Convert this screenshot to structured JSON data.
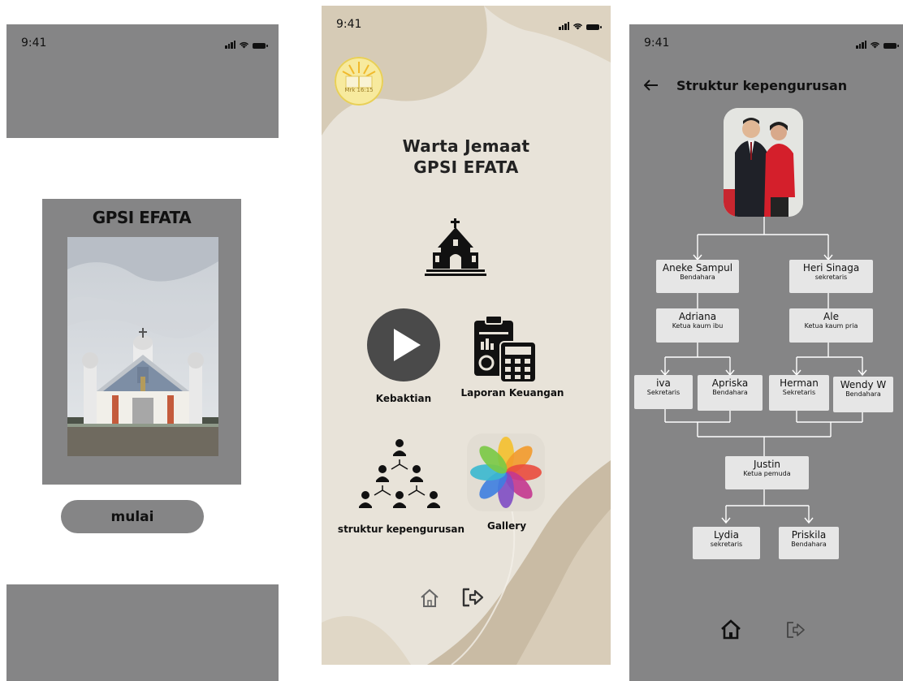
{
  "status_bar": {
    "time": "9:41"
  },
  "screen1": {
    "title": "GPSI EFATA",
    "button_label": "mulai"
  },
  "screen2": {
    "logo_text": "Mrk 16:15",
    "title_line1": "Warta Jemaat",
    "title_line2": "GPSI EFATA",
    "menu": {
      "kebaktian": "Kebaktian",
      "laporan": "Laporan Keuangan",
      "struktur": "struktur kepengurusan",
      "gallery": "Gallery"
    }
  },
  "screen3": {
    "title": "Struktur kepengurusan",
    "nodes": {
      "aneke": {
        "name": "Aneke Sampul",
        "role": "Bendahara"
      },
      "heri": {
        "name": "Heri Sinaga",
        "role": "sekretaris"
      },
      "adriana": {
        "name": "Adriana",
        "role": "Ketua kaum ibu"
      },
      "ale": {
        "name": "Ale",
        "role": "Ketua kaum pria"
      },
      "iva": {
        "name": "iva",
        "role": "Sekretaris"
      },
      "apriska": {
        "name": "Apriska",
        "role": "Bendahara"
      },
      "herman": {
        "name": "Herman",
        "role": "Sekretaris"
      },
      "wendy": {
        "name": "Wendy W",
        "role": "Bendahara"
      },
      "justin": {
        "name": "Justin",
        "role": "Ketua pemuda"
      },
      "lydia": {
        "name": "Lydia",
        "role": "sekretaris"
      },
      "priskila": {
        "name": "Priskila",
        "role": "Bendahara"
      }
    }
  },
  "icons": [
    "church-icon",
    "play-icon",
    "finance-report-icon",
    "org-structure-icon",
    "gallery-icon",
    "home-icon",
    "logout-icon",
    "back-arrow-icon",
    "signal-icon",
    "wifi-icon",
    "battery-icon"
  ],
  "colors": {
    "panel_gray": "#858586",
    "beige_bg": "#e8e3d9",
    "node_bg": "#e6e6e6",
    "play_dark": "#4a4a4a"
  }
}
